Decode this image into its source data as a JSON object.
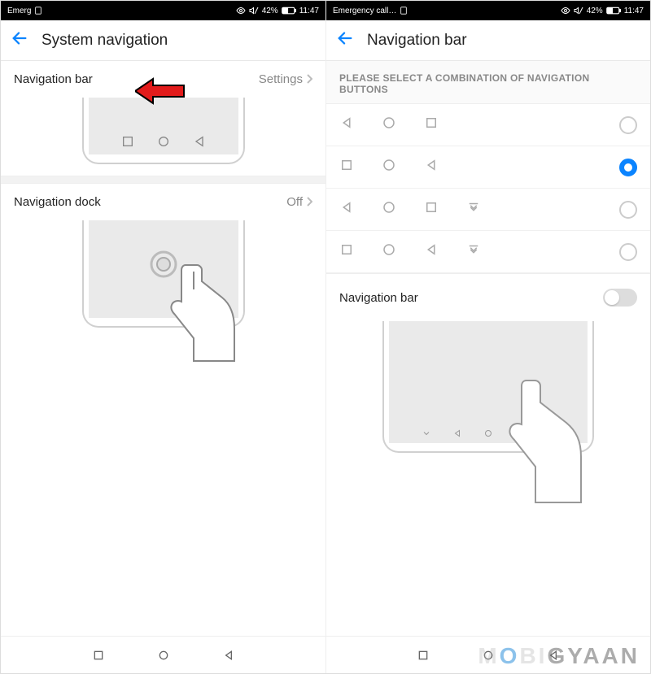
{
  "left": {
    "status": {
      "left": "Emerg",
      "battery": "42%",
      "time": "11:47"
    },
    "header": {
      "title": "System navigation"
    },
    "nav_bar_row": {
      "label": "Navigation bar",
      "value": "Settings"
    },
    "dock_row": {
      "label": "Navigation dock",
      "value": "Off"
    }
  },
  "right": {
    "status": {
      "left": "Emergency call…",
      "battery": "42%",
      "time": "11:47"
    },
    "header": {
      "title": "Navigation bar"
    },
    "section_header": "PLEASE SELECT A COMBINATION OF NAVIGATION BUTTONS",
    "options": [
      {
        "icons": [
          "triangle-left",
          "circle",
          "square"
        ],
        "has_extra": false,
        "selected": false
      },
      {
        "icons": [
          "square",
          "circle",
          "triangle-left"
        ],
        "has_extra": false,
        "selected": true
      },
      {
        "icons": [
          "triangle-left",
          "circle",
          "square"
        ],
        "has_extra": true,
        "selected": false
      },
      {
        "icons": [
          "square",
          "circle",
          "triangle-left"
        ],
        "has_extra": true,
        "selected": false
      }
    ],
    "toggle_row": {
      "label": "Navigation bar",
      "on": false
    }
  },
  "watermark": "MOBIGYAAN"
}
